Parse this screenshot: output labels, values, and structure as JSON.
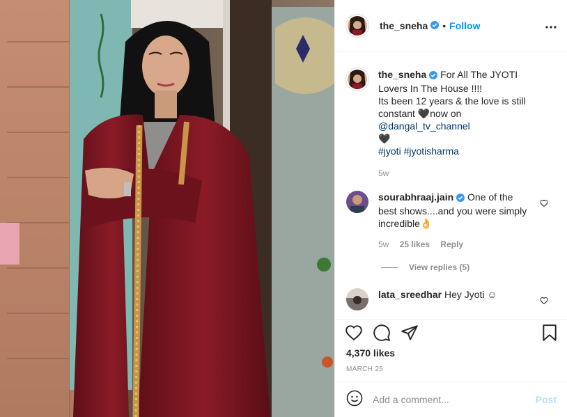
{
  "post": {
    "username": "the_sneha",
    "verified": true,
    "dot": "•",
    "follow_label": "Follow",
    "more_icon": "more-horizontal-icon",
    "photo_description_icon": "post-photo"
  },
  "caption": {
    "username": "the_sneha",
    "text_line_1": "For All The JYOTI Lovers In The House !!!!",
    "text_line_2": "Its been 12 years & the love is still constant",
    "heart_glyph": "🖤",
    "text_now_on": "now on",
    "mention": "@dangal_tv_channel",
    "hashtag_1": "#jyoti",
    "hashtag_2": "#jyotisharma",
    "time": "5w"
  },
  "comments": [
    {
      "username": "sourabhraaj.jain",
      "verified": true,
      "text": "One of the best shows....and you were simply incredible",
      "emoji": "👌",
      "time": "5w",
      "likes": "25 likes",
      "reply_label": "Reply",
      "view_replies": "View replies (5)"
    },
    {
      "username": "lata_sreedhar",
      "verified": false,
      "text": "Hey Jyoti",
      "emoji": "☺"
    }
  ],
  "stats": {
    "likes": "4,370 likes",
    "date": "MARCH 25"
  },
  "add_comment": {
    "placeholder": "Add a comment...",
    "post_label": "Post"
  },
  "colors": {
    "accent": "#0095f6",
    "post_disabled": "#b2dffc",
    "muted": "#8e8e8e",
    "text": "#262626",
    "robe": "#7a1822",
    "border": "#f2a873"
  }
}
